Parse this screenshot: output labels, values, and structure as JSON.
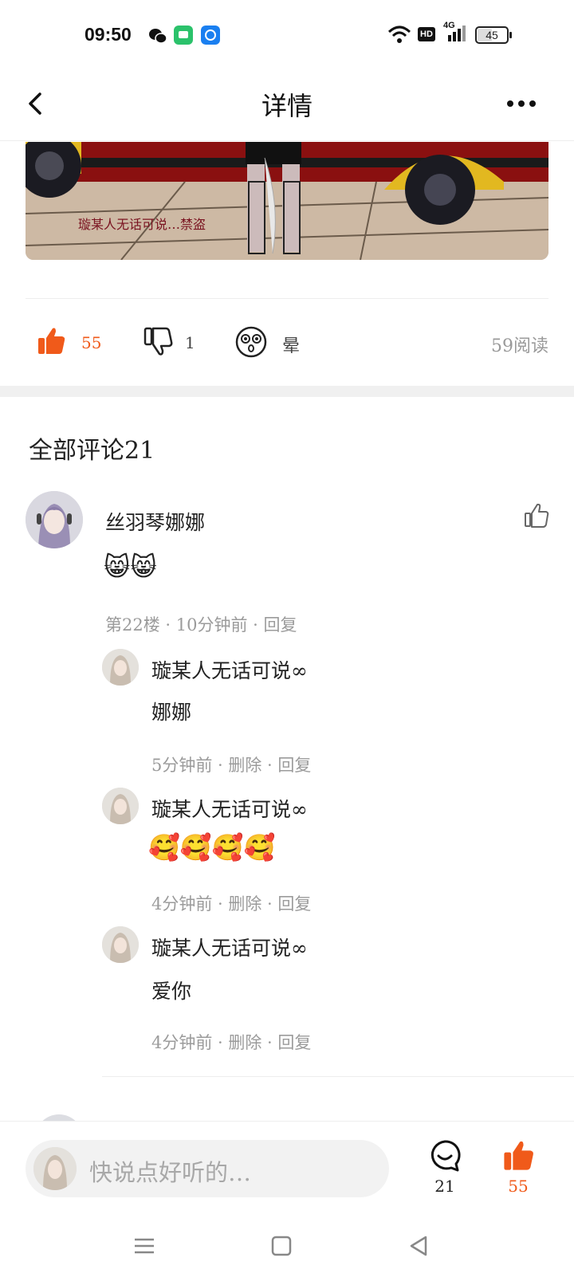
{
  "status_bar": {
    "time": "09:50",
    "battery": "45",
    "network": "4G",
    "hd_label": "HD",
    "app_icons": [
      "wechat-icon",
      "messages-icon",
      "browser-icon"
    ]
  },
  "nav": {
    "title": "详情",
    "back_icon": "chevron-left-icon",
    "more_icon": "more-dots-icon"
  },
  "banner": {
    "watermark_text": "璇某人无话可说…禁盗"
  },
  "actions": {
    "like_count": "55",
    "dislike_count": "1",
    "dizzy_label": "晕",
    "read_count": "59阅读",
    "accent_color": "#f05a1a"
  },
  "comments": {
    "title": "全部评论21",
    "main": {
      "username": "丝羽琴娜娜",
      "content": "😸😸",
      "meta": "第22楼 · 10分钟前 · 回复"
    },
    "replies": [
      {
        "name": "璇某人无话可说∞",
        "text": "娜娜",
        "meta": "5分钟前 · 删除 · 回复"
      },
      {
        "name": "璇某人无话可说∞",
        "text": "🥰🥰🥰🥰",
        "meta": "4分钟前 · 删除 · 回复"
      },
      {
        "name": "璇某人无话可说∞",
        "text": "爱你",
        "meta": "4分钟前 · 删除 · 回复"
      }
    ]
  },
  "bottom_bar": {
    "placeholder": "快说点好听的…",
    "comment_count": "21",
    "like_count": "55"
  },
  "system_nav": {
    "icons": [
      "menu-icon",
      "home-icon",
      "back-triangle-icon"
    ]
  }
}
